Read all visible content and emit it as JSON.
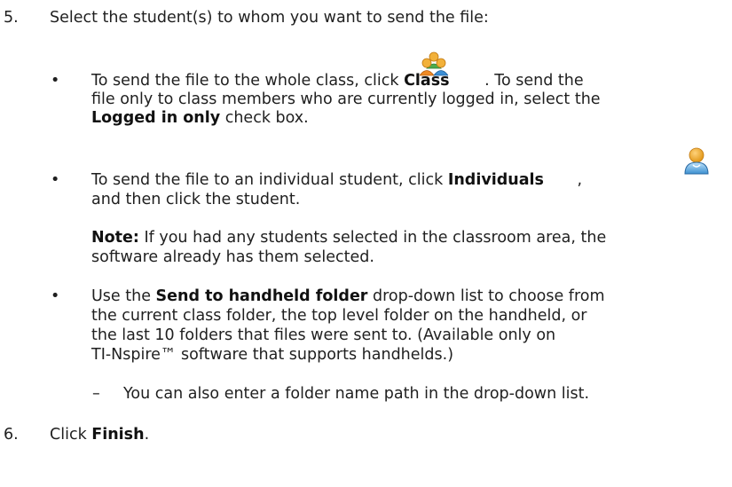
{
  "step5": {
    "number": "5.",
    "text": "Select the student(s) to whom you want to send the file:"
  },
  "bullet_char": "•",
  "dash_char": "–",
  "bullet1": {
    "l1_a": "To send the file to the whole class, click ",
    "l1_bold": "Class",
    "l1_b": ". To send the",
    "l2": "file only to class members who are currently logged in, select the",
    "l3_bold": "Logged in only",
    "l3_b": " check box."
  },
  "bullet2": {
    "l1_a": "To send the file to an individual student, click ",
    "l1_bold": "Individuals",
    "l1_b": ",",
    "l2": "and then click the student."
  },
  "note": {
    "label": "Note:",
    "l1_b": " If you had any students selected in the classroom area, the",
    "l2": "software already has them selected."
  },
  "bullet3": {
    "l1_a": "Use the ",
    "l1_bold": "Send to handheld folder",
    "l1_b": " drop-down list to choose from",
    "l2": "the current class folder, the top level folder on the handheld, or",
    "l3": "the last 10 folders that files were sent to. (Available only on",
    "l4": "TI-Nspire™ software that supports handhelds.)"
  },
  "sub1": {
    "text": "You can also enter a folder name path in the drop-down list."
  },
  "step6": {
    "number": "6.",
    "text_a": "Click ",
    "text_bold": "Finish",
    "text_b": "."
  },
  "icons": {
    "class": "class-group-icon",
    "individual": "individual-student-icon"
  }
}
